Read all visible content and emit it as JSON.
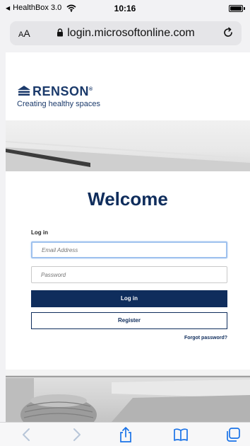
{
  "status_bar": {
    "back_app": "HealthBox 3.0",
    "time": "10:16"
  },
  "browser": {
    "text_size_label": "AA",
    "url": "login.microsoftonline.com"
  },
  "brand": {
    "name": "RENSON",
    "trademark": "®",
    "tagline": "Creating healthy spaces",
    "color": "#1b3a6b"
  },
  "login_form": {
    "title": "Welcome",
    "section_label": "Log in",
    "email_placeholder": "Email Address",
    "password_placeholder": "Password",
    "login_button": "Log in",
    "register_button": "Register",
    "forgot_link": "Forgot password?",
    "accent_color": "#0f2d5c"
  },
  "toolbar": {
    "icons": [
      "back-icon",
      "forward-icon",
      "share-icon",
      "bookmarks-icon",
      "tabs-icon"
    ]
  }
}
